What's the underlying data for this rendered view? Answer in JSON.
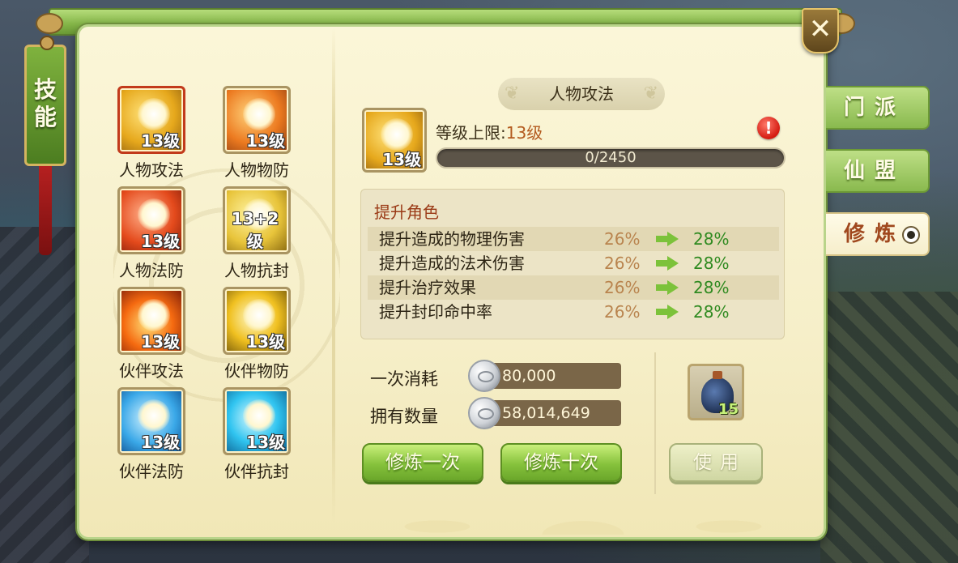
{
  "left_banner": {
    "label": "技\n能"
  },
  "close": {
    "label": "✕"
  },
  "tabs": [
    {
      "label": "门派",
      "active": false
    },
    {
      "label": "仙盟",
      "active": false
    },
    {
      "label": "修炼",
      "active": true
    }
  ],
  "skills": [
    {
      "name": "人物攻法",
      "level": "13级",
      "color": "yellow",
      "selected": true
    },
    {
      "name": "人物物防",
      "level": "13级",
      "color": "orange",
      "selected": false
    },
    {
      "name": "人物法防",
      "level": "13级",
      "color": "red",
      "selected": false
    },
    {
      "name": "人物抗封",
      "level": "13+2级",
      "color": "gold",
      "selected": false
    },
    {
      "name": "伙伴攻法",
      "level": "13级",
      "color": "fire",
      "selected": false
    },
    {
      "name": "伙伴物防",
      "level": "13级",
      "color": "glow",
      "selected": false
    },
    {
      "name": "伙伴法防",
      "level": "13级",
      "color": "blue",
      "selected": false
    },
    {
      "name": "伙伴抗封",
      "level": "13级",
      "color": "cyan",
      "selected": false
    }
  ],
  "detail": {
    "title": "人物攻法",
    "icon_level": "13级",
    "level_cap_label": "等级上限:",
    "level_cap_value": "13级",
    "warn_icon": "!",
    "progress": {
      "text": "0/2450",
      "fraction": 0
    }
  },
  "effects": {
    "header": "提升角色",
    "rows": [
      {
        "label": "提升造成的物理伤害",
        "current": "26%",
        "next": "28%"
      },
      {
        "label": "提升造成的法术伤害",
        "current": "26%",
        "next": "28%"
      },
      {
        "label": "提升治疗效果",
        "current": "26%",
        "next": "28%"
      },
      {
        "label": "提升封印命中率",
        "current": "26%",
        "next": "28%"
      }
    ]
  },
  "cost": {
    "once_label": "一次消耗",
    "once_value": "80,000",
    "own_label": "拥有数量",
    "own_value": "58,014,649",
    "currency_icon": "silver-coin-icon"
  },
  "item": {
    "icon": "potion-bottle-icon",
    "count": "15"
  },
  "buttons": {
    "train_once": "修炼一次",
    "train_ten": "修炼十次",
    "use": "使用"
  },
  "colors": {
    "accent_green": "#86c23c",
    "panel_bg": "#fbf6d8",
    "increase_green": "#2f8a20",
    "current_value": "#b9844e",
    "header_red": "#9a3a16"
  }
}
